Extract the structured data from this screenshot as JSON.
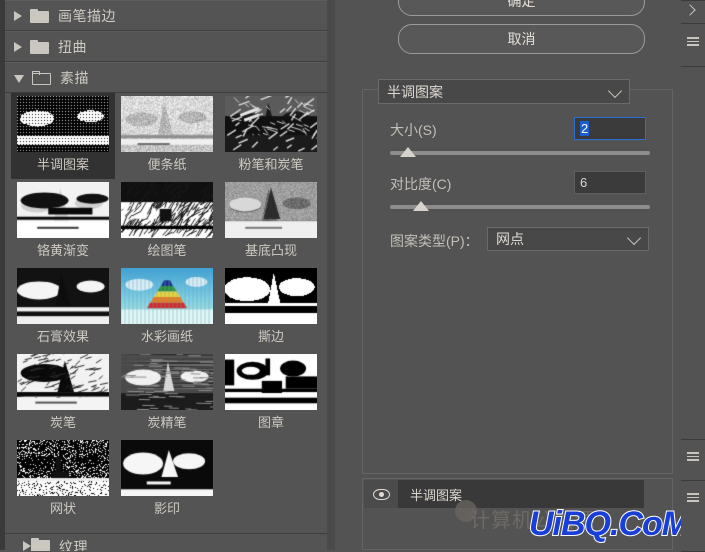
{
  "gallery": {
    "categories": [
      {
        "label": "画笔描边",
        "expanded": false
      },
      {
        "label": "扭曲",
        "expanded": false
      },
      {
        "label": "素描",
        "expanded": true
      },
      {
        "label": "纹理",
        "expanded": false
      }
    ],
    "filters": [
      {
        "label": "半调图案",
        "selected": true,
        "style": "halftone"
      },
      {
        "label": "便条纸",
        "selected": false,
        "style": "notepaper"
      },
      {
        "label": "粉笔和炭笔",
        "selected": false,
        "style": "chalkcharcoal"
      },
      {
        "label": "铬黄渐变",
        "selected": false,
        "style": "chrome"
      },
      {
        "label": "绘图笔",
        "selected": false,
        "style": "graphicpen"
      },
      {
        "label": "基底凸现",
        "selected": false,
        "style": "basrelief"
      },
      {
        "label": "石膏效果",
        "selected": false,
        "style": "plaster"
      },
      {
        "label": "水彩画纸",
        "selected": false,
        "style": "waterpaper"
      },
      {
        "label": "撕边",
        "selected": false,
        "style": "tornedges"
      },
      {
        "label": "炭笔",
        "selected": false,
        "style": "charcoal"
      },
      {
        "label": "炭精笔",
        "selected": false,
        "style": "conte"
      },
      {
        "label": "图章",
        "selected": false,
        "style": "stamp"
      },
      {
        "label": "网状",
        "selected": false,
        "style": "reticulation"
      },
      {
        "label": "影印",
        "selected": false,
        "style": "photocopy"
      }
    ]
  },
  "dialog": {
    "ok_label": "确定",
    "cancel_label": "取消",
    "filter_combo_value": "半调图案",
    "size": {
      "label": "大小(S)",
      "value": "2",
      "slider_percent": 7
    },
    "contrast": {
      "label": "对比度(C)",
      "value": "6",
      "slider_percent": 12
    },
    "pattern_type": {
      "label": "图案类型(P)：",
      "value": "网点"
    }
  },
  "layers": {
    "rows": [
      {
        "name": "半调图案",
        "visible": true,
        "eye_icon": "eye-icon"
      }
    ],
    "ghost_text": "计算机公共课",
    "watermark": "UiBQ.CoM"
  },
  "colors": {
    "panel_bg": "#535353",
    "selected_bg": "#333232",
    "accent_blue": "#1a5fd0",
    "watermark_blue": "#1a3fd6"
  }
}
